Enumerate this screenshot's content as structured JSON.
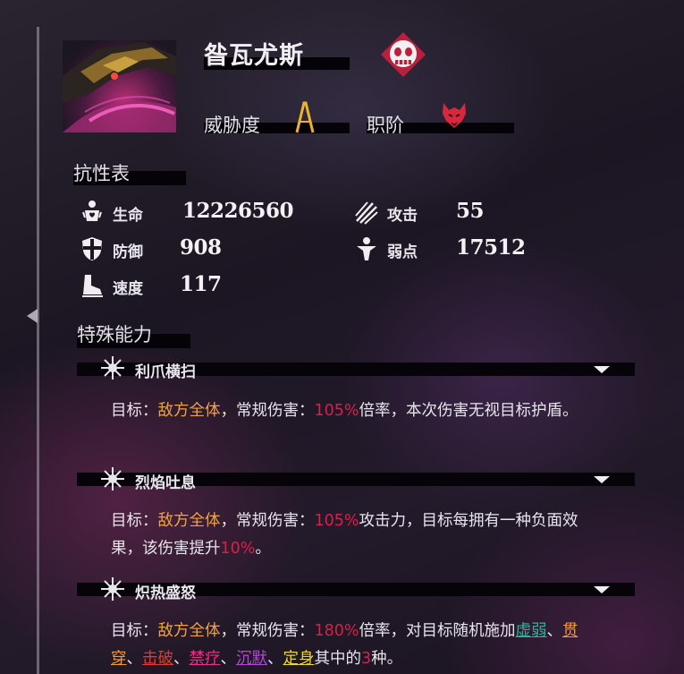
{
  "monster": {
    "name": "昝瓦尤斯",
    "portrait_icon": "dragon-portrait",
    "type_icon": "skull-mask-icon",
    "threat_label": "威胁度",
    "threat_icon": "threat-rank-a-icon",
    "class_label": "职阶",
    "class_icon": "wolf-head-icon"
  },
  "resistance": {
    "title": "抗性表",
    "stats": [
      {
        "label": "生命",
        "value": "12226560",
        "icon": "heart-figure-icon"
      },
      {
        "label": "攻击",
        "value": "55",
        "icon": "claw-icon"
      },
      {
        "label": "防御",
        "value": "908",
        "icon": "shield-icon"
      },
      {
        "label": "弱点",
        "value": "17512",
        "icon": "weakpoint-figure-icon"
      },
      {
        "label": "速度",
        "value": "117",
        "icon": "boot-icon"
      }
    ]
  },
  "abilities": {
    "title": "特殊能力",
    "skills": [
      {
        "name": "利爪横扫",
        "segments": [
          {
            "text": "目标：",
            "color": "plain"
          },
          {
            "text": "敌方全体",
            "color": "orange"
          },
          {
            "text": "，常规伤害：",
            "color": "plain"
          },
          {
            "text": "105%",
            "color": "red"
          },
          {
            "text": "倍率，本次伤害无视目标护盾。",
            "color": "plain"
          }
        ]
      },
      {
        "name": "烈焰吐息",
        "segments": [
          {
            "text": "目标：",
            "color": "plain"
          },
          {
            "text": "敌方全体",
            "color": "orange"
          },
          {
            "text": "，常规伤害：",
            "color": "plain"
          },
          {
            "text": "105%",
            "color": "red"
          },
          {
            "text": "攻击力，目标每拥有一种负面效果，该伤害提升",
            "color": "plain"
          },
          {
            "text": "10%",
            "color": "red"
          },
          {
            "text": "。",
            "color": "plain"
          }
        ]
      },
      {
        "name": "炽热盛怒",
        "segments": [
          {
            "text": "目标：",
            "color": "plain"
          },
          {
            "text": "敌方全体",
            "color": "orange"
          },
          {
            "text": "，常规伤害：",
            "color": "plain"
          },
          {
            "text": "180%",
            "color": "red"
          },
          {
            "text": "倍率，对目标随机施加",
            "color": "plain"
          },
          {
            "text": "虚弱",
            "color": "teal"
          },
          {
            "text": "、",
            "color": "plain"
          },
          {
            "text": "贯穿",
            "color": "ltorange"
          },
          {
            "text": "、",
            "color": "plain"
          },
          {
            "text": "击破",
            "color": "crimson"
          },
          {
            "text": "、",
            "color": "plain"
          },
          {
            "text": "禁疗",
            "color": "pink"
          },
          {
            "text": "、",
            "color": "plain"
          },
          {
            "text": "沉默",
            "color": "purple"
          },
          {
            "text": "、",
            "color": "plain"
          },
          {
            "text": "定身",
            "color": "yellow"
          },
          {
            "text": "其中的",
            "color": "plain"
          },
          {
            "text": "3",
            "color": "red"
          },
          {
            "text": "种。",
            "color": "plain"
          }
        ]
      }
    ]
  },
  "colors": {
    "accent_red": "#d82048",
    "target_orange": "#f0a440",
    "skull_badge": "#b8203c"
  }
}
